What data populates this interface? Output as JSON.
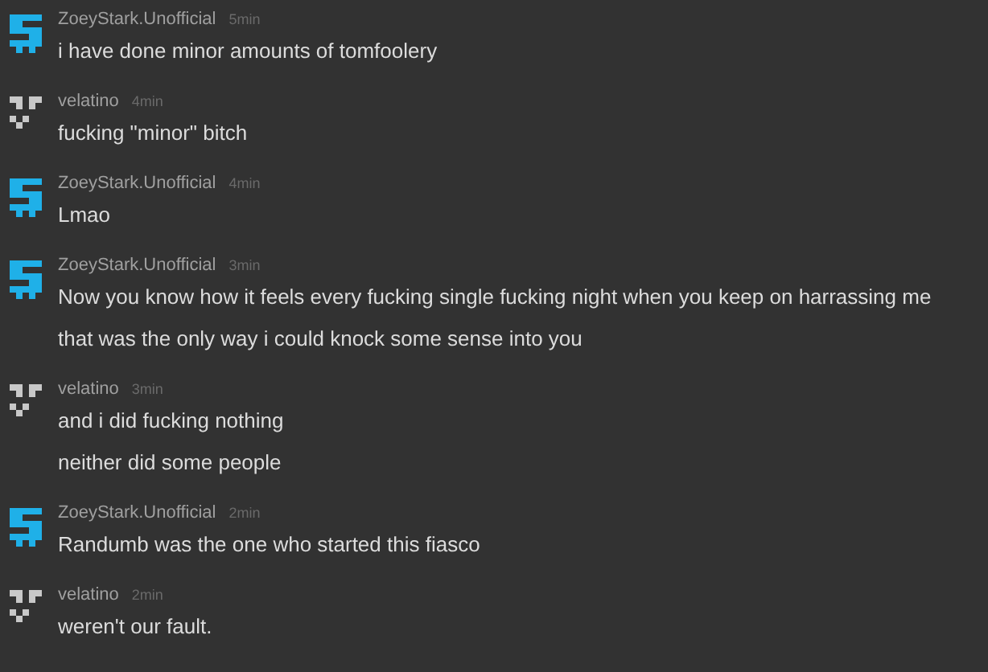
{
  "messages": [
    {
      "author": "ZoeyStark.Unofficial",
      "time": "5min",
      "avatar": {
        "kind": "stripes",
        "color": "#1fb0e8"
      },
      "lines": [
        "i have done minor amounts of tomfoolery"
      ]
    },
    {
      "author": "velatino",
      "time": "4min",
      "avatar": {
        "kind": "cross",
        "color": "#c8c8c8"
      },
      "lines": [
        "fucking \"minor\" bitch"
      ]
    },
    {
      "author": "ZoeyStark.Unofficial",
      "time": "4min",
      "avatar": {
        "kind": "stripes",
        "color": "#1fb0e8"
      },
      "lines": [
        "Lmao"
      ]
    },
    {
      "author": "ZoeyStark.Unofficial",
      "time": "3min",
      "avatar": {
        "kind": "stripes",
        "color": "#1fb0e8"
      },
      "lines": [
        "Now you know how it feels every fucking single fucking night when you keep on harrassing me",
        "that was the only way i could knock some sense into you"
      ]
    },
    {
      "author": "velatino",
      "time": "3min",
      "avatar": {
        "kind": "cross",
        "color": "#c8c8c8"
      },
      "lines": [
        "and i did fucking nothing",
        "neither did some people"
      ]
    },
    {
      "author": "ZoeyStark.Unofficial",
      "time": "2min",
      "avatar": {
        "kind": "stripes",
        "color": "#1fb0e8"
      },
      "lines": [
        "Randumb was the one who started this fiasco"
      ]
    },
    {
      "author": "velatino",
      "time": "2min",
      "avatar": {
        "kind": "cross",
        "color": "#c8c8c8"
      },
      "lines": [
        "weren't our fault."
      ]
    }
  ]
}
